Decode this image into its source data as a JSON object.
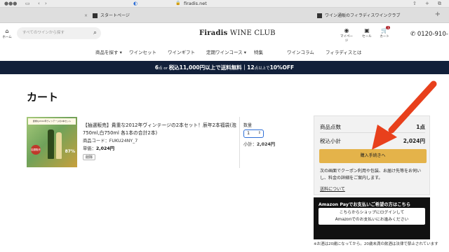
{
  "browser": {
    "url": "firadis.net",
    "tabs": [
      {
        "label": "スタートページ"
      },
      {
        "label": "ワイン通販のフィラディスワインクラブ"
      }
    ]
  },
  "header": {
    "home_label": "ホーム",
    "search_placeholder": "すべてのワインから探す",
    "logo_brand": "Firadis",
    "logo_suffix": "WINE CLUB",
    "mypage_label": "マイページ",
    "sale_label": "セール",
    "cart_label": "カート",
    "cart_count": "1",
    "phone": "0120-910-"
  },
  "nav": {
    "items": [
      "商品を探す ▾",
      "ワインセット",
      "ワインギフト",
      "定期ワインコース ▾",
      "特集",
      "ワインコラム",
      "フィラディスとは"
    ]
  },
  "banner": {
    "part1_count": "6",
    "part1_unit": "点",
    "or": " or ",
    "part1_amount": "税込11,000円以上で送料無料",
    "sep": "｜",
    "part2_count": "12",
    "part2_unit": "点以上で",
    "part2_discount": "10%OFF"
  },
  "page": {
    "title": "カート"
  },
  "product": {
    "name": "【抽選販売】貴重な2012年ヴィンテージの2本セット！辰年2本福袋(泡750ml,白750ml 各1本の合計2本)",
    "code": "商品コード：FUKU24NY_7",
    "price_label": "単価：",
    "price": "2,024円",
    "delete_label": "削除",
    "image_header": "貴重な2012年ヴィンテージの2本セット",
    "image_badge": "抽選販売",
    "image_pct": "87%"
  },
  "quantity": {
    "label": "数量",
    "value": "1",
    "subtotal_label": "小計：",
    "subtotal": "2,024円"
  },
  "summary": {
    "count_label": "商品点数",
    "count_value": "1点",
    "total_label": "税込小計",
    "total_value": "2,024円",
    "checkout_label": "購入手続きへ",
    "note": "次の画面でクーポン利用や包装、お届け先等をお伺いし、料金の詳細をご案内します。",
    "shipping_link": "送料について"
  },
  "amazon": {
    "title": "Amazon Payでお支払いご希望の方はこちら",
    "button_line1": "こちらからショップにログインして",
    "button_line2": "Amazonでのお支払いにお進みください"
  },
  "footnote": "※お酒は20歳になってから。20歳未満の飲酒は法律で禁止されています",
  "colors": {
    "banner_bg": "#12203a",
    "checkout_bg": "#e4b34a",
    "arrow": "#e8401c"
  }
}
